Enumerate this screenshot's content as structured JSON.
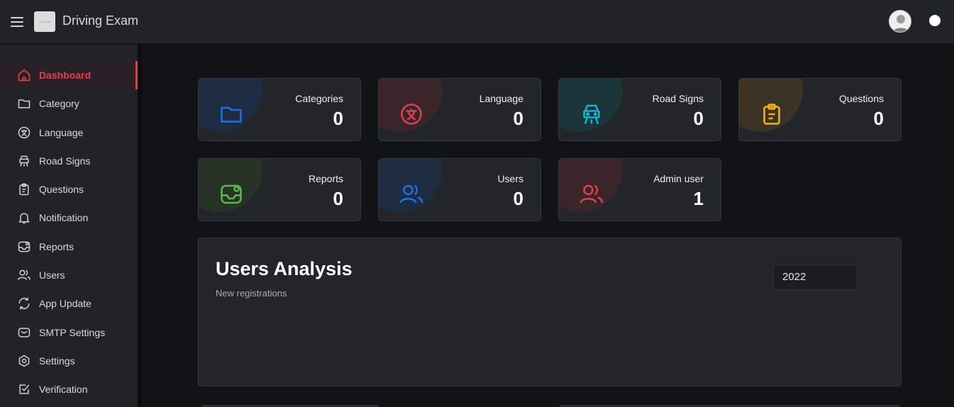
{
  "header": {
    "app_title": "Driving Exam",
    "logo_text": "Driv Exm",
    "menu_icon": "hamburger-icon",
    "avatar_icon": "user-avatar",
    "toggle_icon": "theme-toggle"
  },
  "sidebar": {
    "items": [
      {
        "label": "Dashboard",
        "icon": "home-icon",
        "active": true
      },
      {
        "label": "Category",
        "icon": "folder-icon"
      },
      {
        "label": "Language",
        "icon": "language-icon"
      },
      {
        "label": "Road Signs",
        "icon": "car-icon"
      },
      {
        "label": "Questions",
        "icon": "clipboard-icon"
      },
      {
        "label": "Notification",
        "icon": "bell-icon"
      },
      {
        "label": "Reports",
        "icon": "inbox-icon"
      },
      {
        "label": "Users",
        "icon": "users-icon"
      },
      {
        "label": "App Update",
        "icon": "refresh-icon"
      },
      {
        "label": "SMTP Settings",
        "icon": "mail-icon"
      },
      {
        "label": "Settings",
        "icon": "gear-icon"
      },
      {
        "label": "Verification",
        "icon": "check-square-icon"
      }
    ]
  },
  "stats": [
    {
      "label": "Categories",
      "value": "0",
      "icon": "folder-icon",
      "color": "#1e6fe8"
    },
    {
      "label": "Language",
      "value": "0",
      "icon": "language-icon",
      "color": "#e0404e"
    },
    {
      "label": "Road Signs",
      "value": "0",
      "icon": "car-icon",
      "color": "#17b2d6"
    },
    {
      "label": "Questions",
      "value": "0",
      "icon": "clipboard-icon",
      "color": "#f2b31a"
    },
    {
      "label": "Reports",
      "value": "0",
      "icon": "inbox-icon",
      "color": "#5cb84a"
    },
    {
      "label": "Users",
      "value": "0",
      "icon": "users-icon",
      "color": "#1e6fe8"
    },
    {
      "label": "Admin user",
      "value": "1",
      "icon": "users-icon",
      "color": "#e0404e"
    }
  ],
  "analysis": {
    "title": "Users Analysis",
    "subtitle": "New registrations",
    "year": "2022"
  },
  "colors": {
    "accent": "#e0404e",
    "background": "#111316",
    "surface": "#22252a"
  }
}
